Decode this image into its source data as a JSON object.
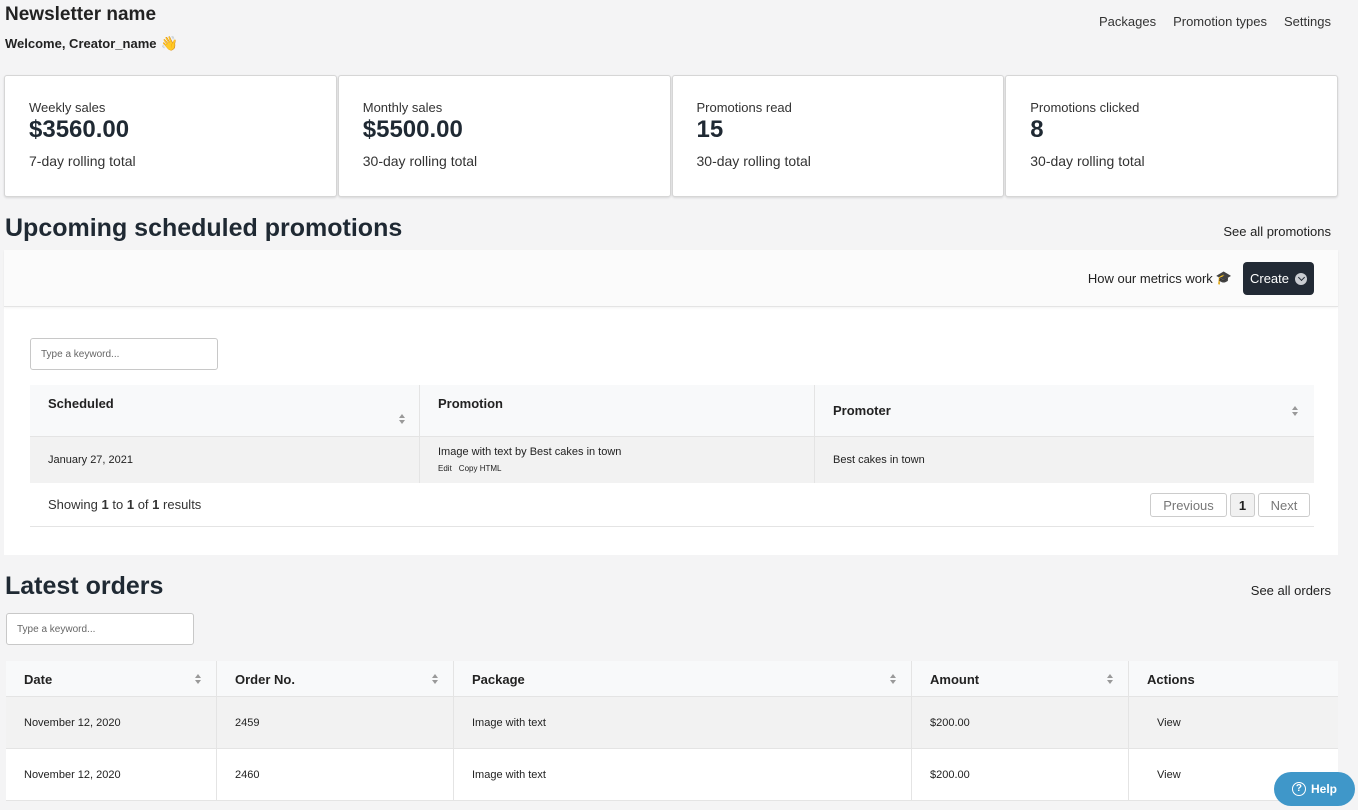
{
  "header": {
    "newsletter_name": "Newsletter name",
    "welcome": "Welcome, Creator_name",
    "wave_emoji": "👋"
  },
  "nav": {
    "packages": "Packages",
    "promotion_types": "Promotion types",
    "settings": "Settings"
  },
  "stats": [
    {
      "label": "Weekly sales",
      "value": "$3560.00",
      "sub": "7-day rolling total"
    },
    {
      "label": "Monthly sales",
      "value": "$5500.00",
      "sub": "30-day rolling total"
    },
    {
      "label": "Promotions read",
      "value": "15",
      "sub": "30-day rolling total"
    },
    {
      "label": "Promotions clicked",
      "value": "8",
      "sub": "30-day rolling total"
    }
  ],
  "promotions": {
    "title": "Upcoming scheduled promotions",
    "see_all": "See all promotions",
    "metrics_link": "How our metrics work",
    "metrics_emoji": "🎓",
    "create_label": "Create",
    "search_placeholder": "Type a keyword...",
    "columns": [
      "Scheduled",
      "Promotion",
      "Promoter"
    ],
    "rows": [
      {
        "scheduled": "January 27, 2021",
        "promotion": "Image with text by Best cakes in town",
        "edit": "Edit",
        "copy_html": "Copy HTML",
        "promoter": "Best cakes in town"
      }
    ],
    "footer": {
      "showing_prefix": "Showing",
      "from": "1",
      "to_word": "to",
      "to": "1",
      "of_word": "of",
      "total": "1",
      "suffix": "results"
    },
    "pager": {
      "previous": "Previous",
      "page": "1",
      "next": "Next"
    }
  },
  "orders": {
    "title": "Latest orders",
    "see_all": "See all orders",
    "search_placeholder": "Type a keyword...",
    "columns": [
      "Date",
      "Order No.",
      "Package",
      "Amount",
      "Actions"
    ],
    "rows": [
      {
        "date": "November 12, 2020",
        "order_no": "2459",
        "package": "Image with text",
        "amount": "$200.00",
        "action": "View"
      },
      {
        "date": "November 12, 2020",
        "order_no": "2460",
        "package": "Image with text",
        "amount": "$200.00",
        "action": "View"
      }
    ]
  },
  "help": {
    "label": "Help",
    "icon": "?"
  }
}
